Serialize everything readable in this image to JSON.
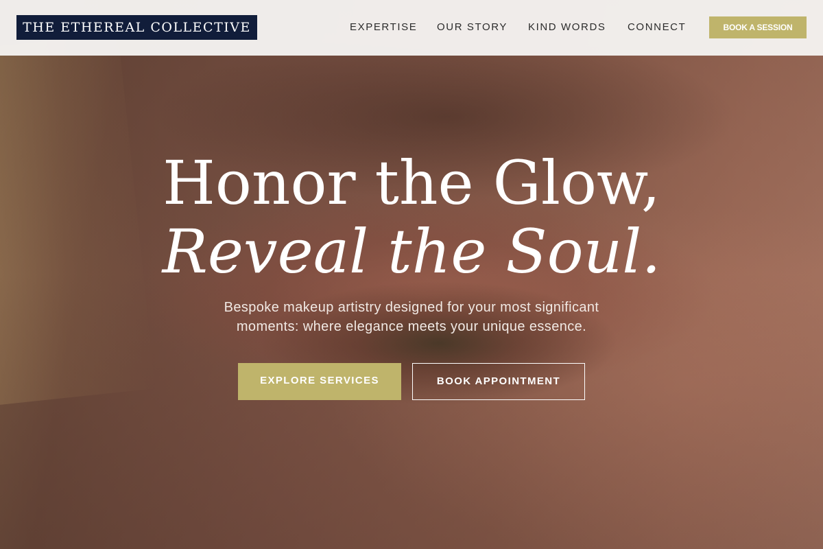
{
  "header": {
    "logo_text": "THE ETHEREAL COLLECTIVE",
    "nav": {
      "expertise": "EXPERTISE",
      "our_story": "OUR STORY",
      "kind_words": "KIND WORDS",
      "connect": "CONNECT"
    },
    "cta_label": "BOOK A SESSION"
  },
  "hero": {
    "headline_line1": "Honor the Glow,",
    "headline_line2": "Reveal the Soul.",
    "subtitle": "Bespoke makeup artistry designed for your most significant moments: where elegance meets your unique essence.",
    "primary_button": "EXPLORE SERVICES",
    "secondary_button": "BOOK APPOINTMENT"
  },
  "colors": {
    "logo_background": "#111d3a",
    "accent_gold": "#bfb46b",
    "header_background": "#f4f2f0",
    "nav_text": "#2b2b2b",
    "hero_text": "#ffffff"
  }
}
